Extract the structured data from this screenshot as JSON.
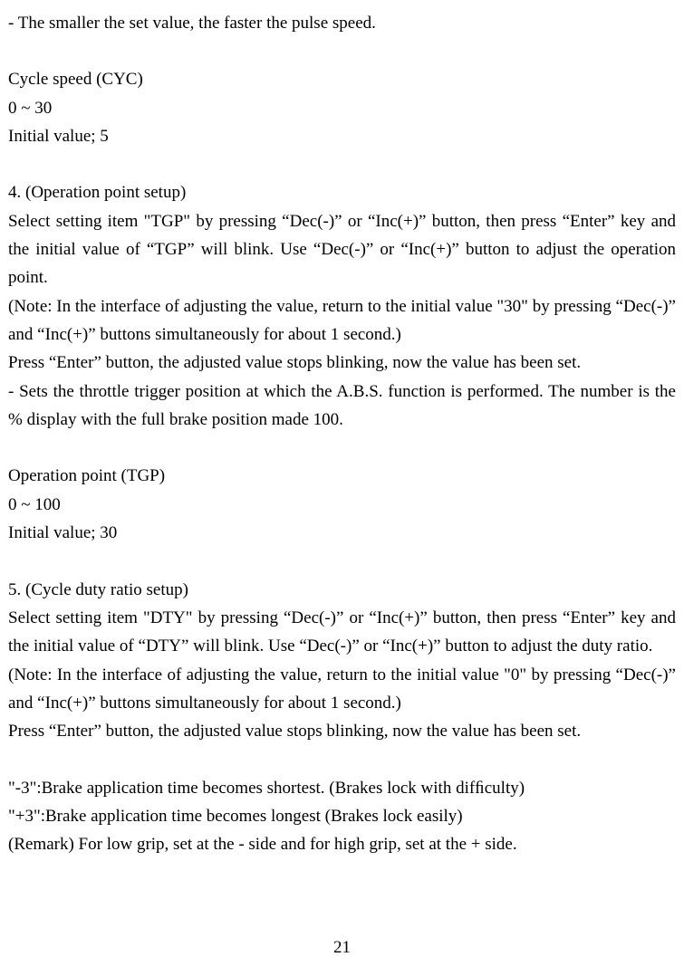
{
  "line1": "- The smaller the set value, the faster the pulse speed.",
  "cyc_title": "Cycle speed (CYC)",
  "cyc_range": "0 ~    30",
  "cyc_initial": "Initial value; 5",
  "section4_heading": "4. (Operation point setup)",
  "section4_p1": "Select setting item \"TGP\" by pressing “Dec(-)” or “Inc(+)” button, then press “Enter” key and the initial value of “TGP” will blink. Use “Dec(-)” or “Inc(+)” button to adjust the operation point.",
  "section4_p2": "(Note: In the interface of adjusting the value, return to the initial value \"30\" by pressing “Dec(-)” and “Inc(+)” buttons simultaneously for about 1 second.)",
  "section4_p3": "Press   “Enter” button, the adjusted value stops blinking, now the value has been set.",
  "section4_p4": "- Sets the throttle trigger position at which the A.B.S. function is performed. The number is the % display with the full brake position made 100.",
  "tgp_title": "Operation point (TGP)",
  "tgp_range": "0 ~    100",
  "tgp_initial": "Initial value; 30",
  "section5_heading": "5. (Cycle duty ratio setup)",
  "section5_p1": "Select setting item \"DTY\" by pressing “Dec(-)” or “Inc(+)” button, then press “Enter” key and the initial value of “DTY” will blink. Use “Dec(-)” or “Inc(+)” button to adjust the duty ratio.",
  "section5_p2": "(Note: In the interface of adjusting the value, return to the initial value \"0\" by pressing “Dec(-)” and “Inc(+)” buttons simultaneously for about 1 second.)",
  "section5_p3": "Press “Enter” button, the adjusted value stops blinking, now the value has been set.",
  "dty_line1": "\"-3\":Brake application time becomes shortest. (Brakes lock with difﬁculty)",
  "dty_line2": "\"+3\":Brake application time becomes longest (Brakes lock easily)",
  "dty_remark": "(Remark) For low grip, set at the - side and for high grip, set at the + side.",
  "page_number": "21"
}
